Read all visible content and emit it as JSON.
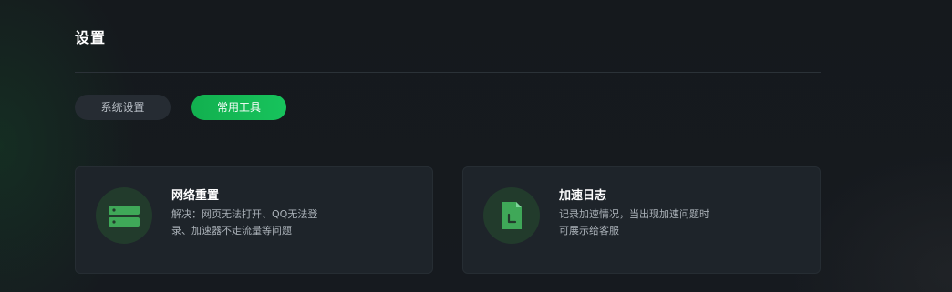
{
  "page": {
    "title": "设置"
  },
  "tabs": [
    {
      "label": "系统设置",
      "active": false
    },
    {
      "label": "常用工具",
      "active": true
    }
  ],
  "cards": [
    {
      "title": "网络重置",
      "desc_lines": [
        "解决：网页无法打开、QQ无法登",
        "录、加速器不走流量等问题"
      ],
      "icon": "server-icon"
    },
    {
      "title": "加速日志",
      "desc_lines": [
        "记录加速情况，当出现加速问题时",
        "可展示给客服"
      ],
      "icon": "log-file-icon"
    }
  ],
  "colors": {
    "accent": "#17c35c",
    "background": "#161a1f",
    "card": "#1e242a"
  }
}
